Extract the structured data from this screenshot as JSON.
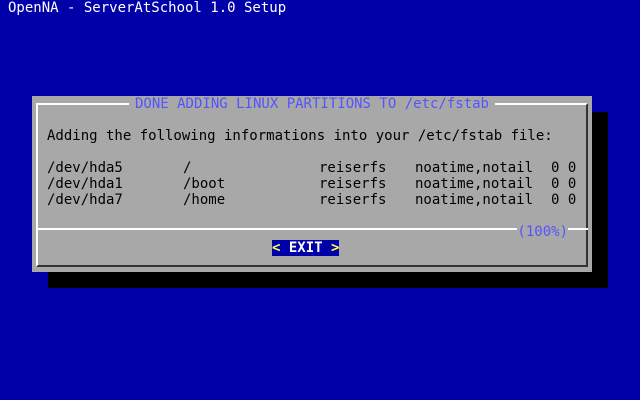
{
  "backtitle": "OpenNA - ServerAtSchool 1.0 Setup",
  "dialog": {
    "title": "DONE ADDING LINUX PARTITIONS TO /etc/fstab",
    "intro": "Adding the following informations into your /etc/fstab file:",
    "entries": [
      {
        "device": "/dev/hda5",
        "mount": "/",
        "fstype": "reiserfs",
        "options": "noatime,notail",
        "dump_pass": "0 0"
      },
      {
        "device": "/dev/hda1",
        "mount": "/boot",
        "fstype": "reiserfs",
        "options": "noatime,notail",
        "dump_pass": "0 0"
      },
      {
        "device": "/dev/hda7",
        "mount": "/home",
        "fstype": "reiserfs",
        "options": "noatime,notail",
        "dump_pass": "0 0"
      }
    ],
    "scroll_percent": "(100%)",
    "exit_button": {
      "left_bracket": "<",
      "label": "EXIT",
      "right_bracket": ">"
    }
  },
  "colors": {
    "background": "#0000A8",
    "dialog": "#A8A8A8",
    "title": "#5454FC",
    "button_bg": "#0000A8",
    "button_text": "#FFFFFF"
  }
}
